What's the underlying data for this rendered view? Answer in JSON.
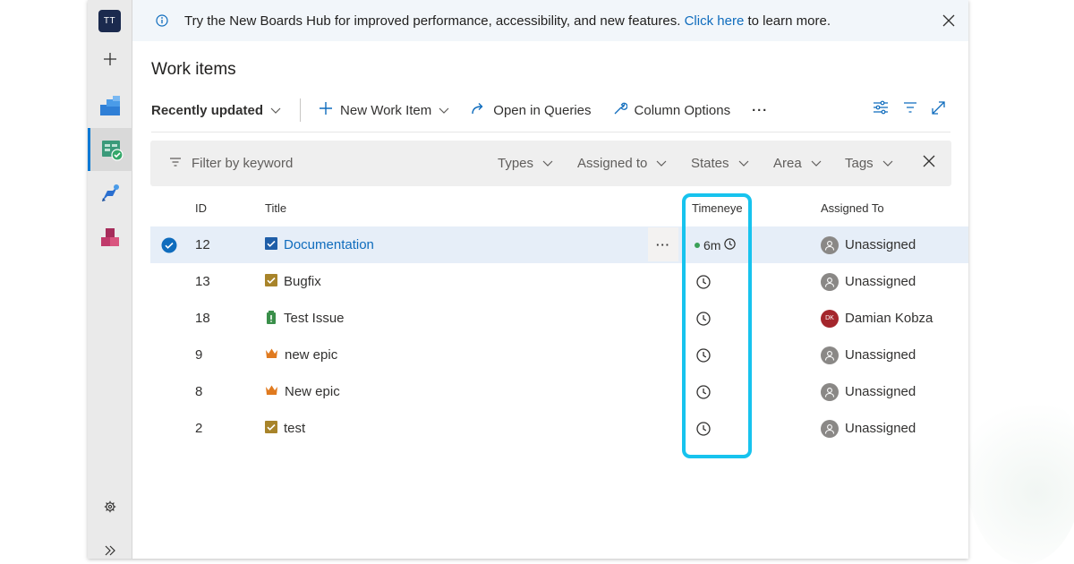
{
  "colors": {
    "accent": "#0f6cbd",
    "highlight": "#17c3ee",
    "rail_active": "#0078d4",
    "selected_row": "#e6eef8"
  },
  "rail": {
    "avatar_initials": "TT"
  },
  "banner": {
    "text_before": "Try the New Boards Hub for improved performance, accessibility, and new features.",
    "link_text": "Click here",
    "text_after": "to learn more."
  },
  "page_title": "Work items",
  "toolbar": {
    "view_label": "Recently updated",
    "new_item_label": "New Work Item",
    "open_queries_label": "Open in Queries",
    "column_options_label": "Column Options",
    "more_label": "···"
  },
  "filter": {
    "placeholder": "Filter by keyword",
    "chips": [
      "Types",
      "Assigned to",
      "States",
      "Area",
      "Tags"
    ]
  },
  "table": {
    "headers": {
      "id": "ID",
      "title": "Title",
      "timeneye": "Timeneye",
      "assigned_to": "Assigned To"
    },
    "rows": [
      {
        "id": "12",
        "title": "Documentation",
        "type": "task",
        "timer": "6m",
        "assigned": "Unassigned",
        "avatar": "unassigned",
        "selected": true
      },
      {
        "id": "13",
        "title": "Bugfix",
        "type": "task-olive",
        "timer": "",
        "assigned": "Unassigned",
        "avatar": "unassigned",
        "selected": false
      },
      {
        "id": "18",
        "title": "Test Issue",
        "type": "issue",
        "timer": "",
        "assigned": "Damian Kobza",
        "avatar": "DK",
        "selected": false
      },
      {
        "id": "9",
        "title": "new epic",
        "type": "epic",
        "timer": "",
        "assigned": "Unassigned",
        "avatar": "unassigned",
        "selected": false
      },
      {
        "id": "8",
        "title": "New epic",
        "type": "epic",
        "timer": "",
        "assigned": "Unassigned",
        "avatar": "unassigned",
        "selected": false
      },
      {
        "id": "2",
        "title": "test",
        "type": "task-olive",
        "timer": "",
        "assigned": "Unassigned",
        "avatar": "unassigned",
        "selected": false
      }
    ],
    "row_more_label": "···"
  }
}
